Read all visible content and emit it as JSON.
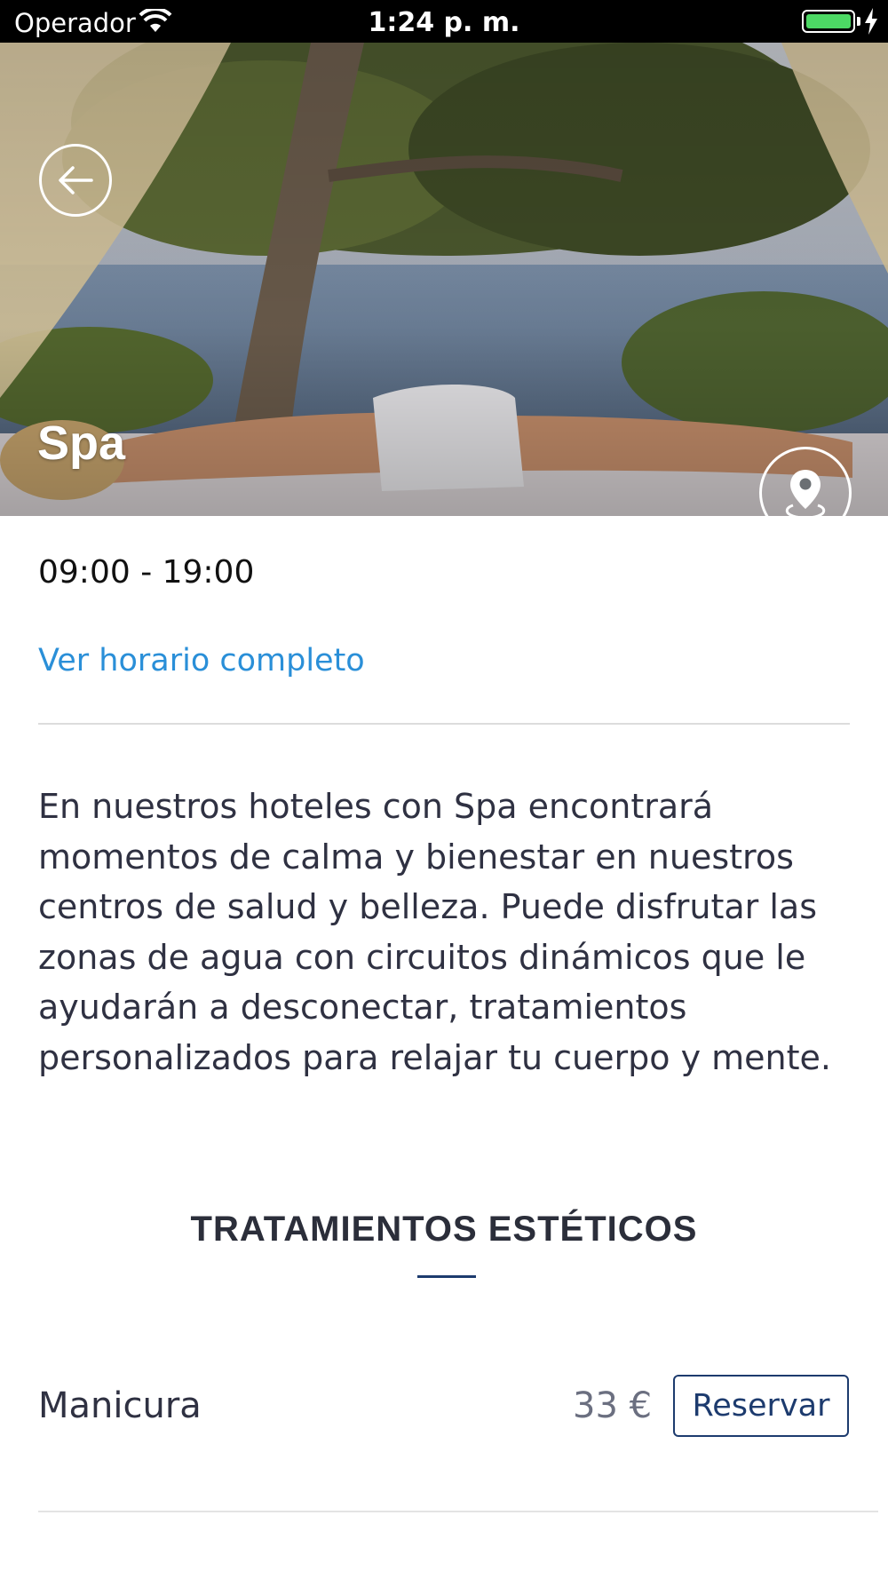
{
  "status_bar": {
    "carrier": "Operador",
    "time": "1:24 p. m.",
    "battery_color": "#4cd964"
  },
  "hero": {
    "title": "Spa",
    "back_icon": "arrow-left-icon",
    "map_icon": "map-pin-icon"
  },
  "hours": {
    "range": "09:00 - 19:00",
    "link": "Ver horario completo"
  },
  "description": "En nuestros hoteles con Spa encontrará momentos de calma y bienestar en nuestros centros de salud y belleza. Puede disfrutar las zonas de agua con circuitos dinámicos que le ayudarán a desconectar, tratamientos personalizados para relajar tu cuerpo y mente.",
  "section": {
    "title": "TRATAMIENTOS ESTÉTICOS"
  },
  "treatments": [
    {
      "name": "Manicura",
      "price": "33 €",
      "button": "Reservar"
    }
  ],
  "colors": {
    "link": "#2a8fd8",
    "accent": "#1d3b6e"
  }
}
